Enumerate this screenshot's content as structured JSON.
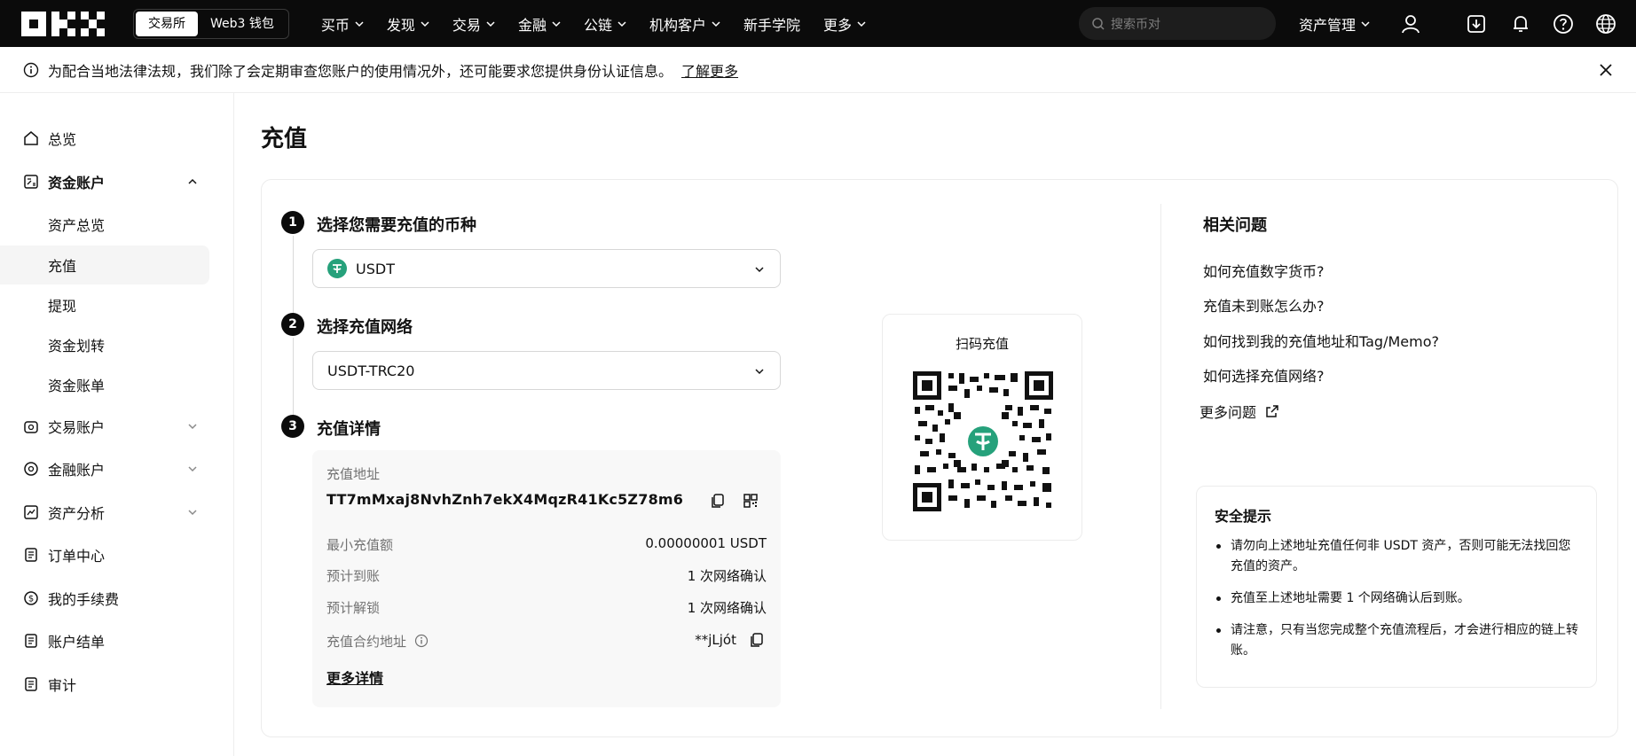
{
  "topbar": {
    "switch": [
      "交易所",
      "Web3 钱包"
    ],
    "nav": [
      "买币",
      "发现",
      "交易",
      "金融",
      "公链",
      "机构客户",
      "新手学院",
      "更多"
    ],
    "nav_has_chevron": [
      true,
      true,
      true,
      true,
      true,
      true,
      false,
      true
    ],
    "search_placeholder": "搜索币对",
    "asset_mgmt": "资产管理"
  },
  "notice": {
    "text": "为配合当地法律法规，我们除了会定期审查您账户的使用情况外，还可能要求您提供身份认证信息。",
    "link": "了解更多"
  },
  "sidebar": {
    "overview": "总览",
    "funding": "资金账户",
    "funding_sub": [
      "资产总览",
      "充值",
      "提现",
      "资金划转",
      "资金账单"
    ],
    "trading": "交易账户",
    "finance": "金融账户",
    "analysis": "资产分析",
    "orders": "订单中心",
    "fees": "我的手续费",
    "statements": "账户结单",
    "audit": "审计"
  },
  "main": {
    "title": "充值",
    "step1": {
      "num": "1",
      "title": "选择您需要充值的币种",
      "value": "USDT"
    },
    "step2": {
      "num": "2",
      "title": "选择充值网络",
      "value": "USDT-TRC20"
    },
    "step3": {
      "num": "3",
      "title": "充值详情"
    },
    "details": {
      "address_label": "充值地址",
      "address": "TT7mMxaj8NvhZnh7ekX4MqzR41Kc5Z78m6",
      "min_label": "最小充值额",
      "min_value": "0.00000001 USDT",
      "arrive_label": "预计到账",
      "arrive_value": "1 次网络确认",
      "unlock_label": "预计解锁",
      "unlock_value": "1 次网络确认",
      "contract_label": "充值合约地址",
      "contract_value": "**jLjót",
      "more": "更多详情"
    },
    "qr_title": "扫码充值"
  },
  "faq": {
    "title": "相关问题",
    "items": [
      "如何充值数字货币?",
      "充值未到账怎么办?",
      "如何找到我的充值地址和Tag/Memo?",
      "如何选择充值网络?"
    ],
    "more": "更多问题"
  },
  "safety": {
    "title": "安全提示",
    "tips": [
      "请勿向上述地址充值任何非 USDT 资产，否则可能无法找回您充值的资产。",
      "充值至上述地址需要 1 个网络确认后到账。",
      "请注意，只有当您完成整个充值流程后，才会进行相应的链上转账。"
    ]
  },
  "colors": {
    "accent": "#0b0b0b",
    "tether": "#26a17b",
    "muted": "#727272"
  }
}
